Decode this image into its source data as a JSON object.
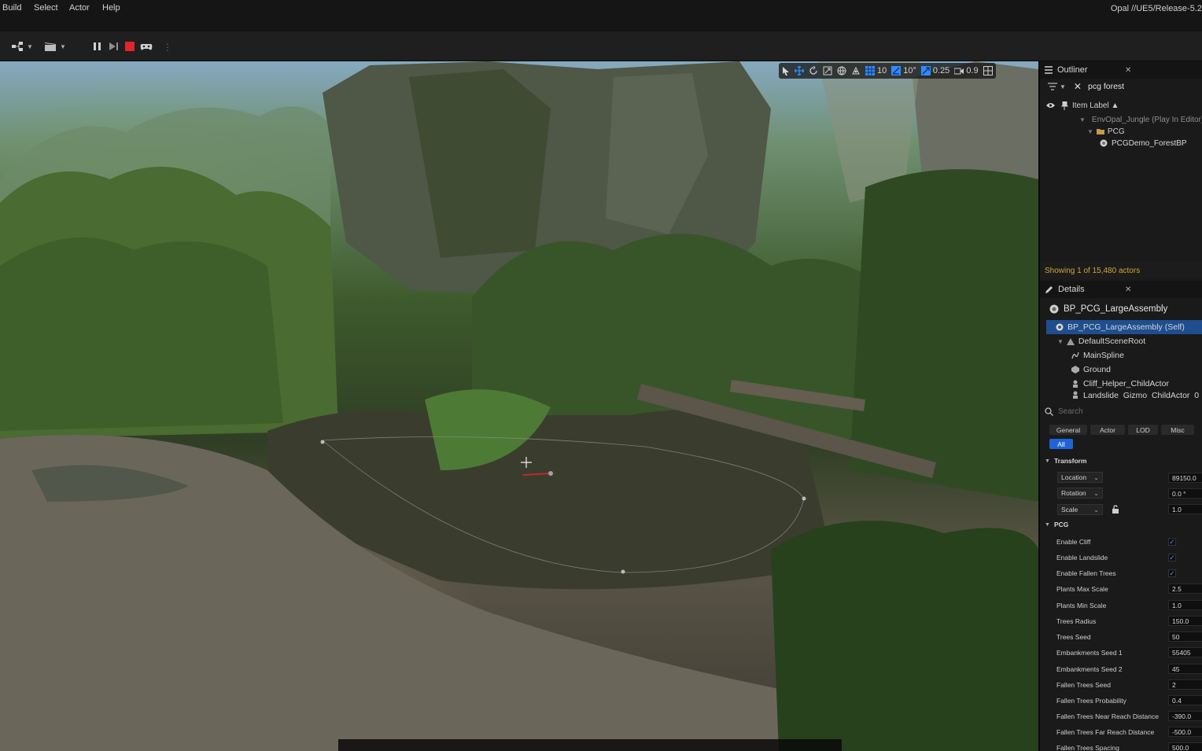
{
  "menu": {
    "items": [
      "Build",
      "Select",
      "Actor",
      "Help"
    ],
    "project_path": "Opal //UE5/Release-5.2"
  },
  "viewport_tools": {
    "grid_snap": "10",
    "rotation_snap": "10°",
    "scale_snap": "0.25",
    "camera_speed": "0.9"
  },
  "outliner": {
    "title": "Outliner",
    "close_icon": "close-icon",
    "search_value": "pcg forest",
    "column_label": "Item Label ▲",
    "tree": [
      {
        "label": "EnvOpal_Jungle (Play In Editor)",
        "icon": "world-icon"
      },
      {
        "label": "PCG",
        "icon": "folder-icon"
      },
      {
        "label": "PCGDemo_ForestBP",
        "icon": "actor-icon"
      }
    ],
    "status": "Showing 1 of 15,480 actors"
  },
  "details": {
    "title": "Details",
    "actor_name": "BP_PCG_LargeAssembly",
    "components": [
      {
        "label": "BP_PCG_LargeAssembly (Self)",
        "icon": "actor-icon"
      },
      {
        "label": "DefaultSceneRoot",
        "icon": "scene-root-icon"
      },
      {
        "label": "MainSpline",
        "icon": "spline-icon"
      },
      {
        "label": "Ground",
        "icon": "mesh-icon"
      },
      {
        "label": "Cliff_Helper_ChildActor",
        "icon": "child-actor-icon"
      },
      {
        "label": "Landslide_Gizmo_ChildActor_0",
        "icon": "child-actor-icon"
      }
    ],
    "search_placeholder": "Search",
    "filter_tabs": [
      "General",
      "Actor",
      "LOD",
      "Misc",
      "All"
    ],
    "transform": {
      "section": "Transform",
      "location": {
        "label": "Location",
        "value": "89150.0"
      },
      "rotation": {
        "label": "Rotation",
        "value": "0.0 °"
      },
      "scale": {
        "label": "Scale",
        "value": "1.0"
      }
    },
    "pcg": {
      "section": "PCG",
      "props": [
        {
          "label": "Enable Cliff",
          "type": "check",
          "value": true
        },
        {
          "label": "Enable Landslide",
          "type": "check",
          "value": true
        },
        {
          "label": "Enable Fallen Trees",
          "type": "check",
          "value": true
        },
        {
          "label": "Plants Max Scale",
          "type": "num",
          "value": "2.5"
        },
        {
          "label": "Plants Min Scale",
          "type": "num",
          "value": "1.0"
        },
        {
          "label": "Trees Radius",
          "type": "num",
          "value": "150.0"
        },
        {
          "label": "Trees Seed",
          "type": "num",
          "value": "50"
        },
        {
          "label": "Embankments Seed 1",
          "type": "num",
          "value": "55405"
        },
        {
          "label": "Embankments Seed 2",
          "type": "num",
          "value": "45"
        },
        {
          "label": "Fallen Trees Seed",
          "type": "num",
          "value": "2"
        },
        {
          "label": "Fallen Trees Probability",
          "type": "num",
          "value": "0.4"
        },
        {
          "label": "Fallen Trees Near Reach Distance",
          "type": "num",
          "value": "-390.0"
        },
        {
          "label": "Fallen Trees Far Reach Distance",
          "type": "num",
          "value": "-500.0"
        },
        {
          "label": "Fallen Trees Spacing",
          "type": "num",
          "value": "500.0"
        }
      ]
    }
  },
  "colors": {
    "accent": "#1d64d6",
    "status_text": "#d0a53a",
    "checkmark": "#3d8fff"
  }
}
